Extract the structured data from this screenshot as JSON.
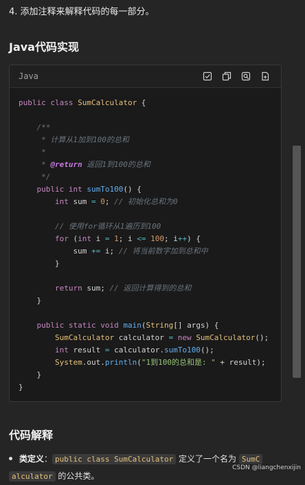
{
  "step_text": "4. 添加注释来解释代码的每一部分。",
  "java_heading": "Java代码实现",
  "code_block": {
    "language": "Java",
    "tools": [
      "check-icon",
      "copy-icon",
      "search-code-icon",
      "insert-icon"
    ],
    "lines": {
      "l1_a": "public class ",
      "l1_b": "SumCalculator",
      "l1_c": " {",
      "l3": "    /**",
      "l4": "     * 计算从1加到100的总和",
      "l5": "     *",
      "l6_a": "     * ",
      "l6_b": "@return",
      "l6_c": " 返回1到100的总和",
      "l7": "     */",
      "l8_a": "    public int ",
      "l8_b": "sumTo100",
      "l8_c": "() {",
      "l9_a": "        int",
      "l9_b": " sum ",
      "l9_c": "=",
      "l9_d": " 0",
      "l9_e": "; ",
      "l9_f": "// 初始化总和为0",
      "l11": "        // 使用for循环从1遍历到100",
      "l12_a": "        for",
      "l12_b": " (",
      "l12_c": "int",
      "l12_d": " i ",
      "l12_e": "=",
      "l12_f": " 1",
      "l12_g": "; i ",
      "l12_h": "<=",
      "l12_i": " 100",
      "l12_j": "; i",
      "l12_k": "++",
      "l12_l": ") {",
      "l13_a": "            sum ",
      "l13_b": "+=",
      "l13_c": " i; ",
      "l13_d": "// 将当前数字加到总和中",
      "l14": "        }",
      "l16_a": "        return",
      "l16_b": " sum; ",
      "l16_c": "// 返回计算得到的总和",
      "l17": "    }",
      "l19_a": "    public static void ",
      "l19_b": "main",
      "l19_c": "(",
      "l19_d": "String",
      "l19_e": "[] args) {",
      "l20_a": "        SumCalculator",
      "l20_b": " calculator ",
      "l20_c": "=",
      "l20_d": " new ",
      "l20_e": "SumCalculator",
      "l20_f": "();",
      "l21_a": "        int",
      "l21_b": " result ",
      "l21_c": "=",
      "l21_d": " calculator.",
      "l21_e": "sumTo100",
      "l21_f": "();",
      "l22_a": "        System",
      "l22_b": ".out.",
      "l22_c": "println",
      "l22_d": "(",
      "l22_e": "\"1到100的总和是: \"",
      "l22_f": " + result);",
      "l23": "    }",
      "l24": "}"
    }
  },
  "explain_heading": "代码解释",
  "bullet": {
    "label": "类定义",
    "colon": "：",
    "code1": "public class SumCalculator",
    "mid": " 定义了一个名为 ",
    "code2a": "SumC",
    "code2b": "alculator",
    "end": " 的公共类。"
  },
  "watermark": "CSDN @liangchenxijin"
}
